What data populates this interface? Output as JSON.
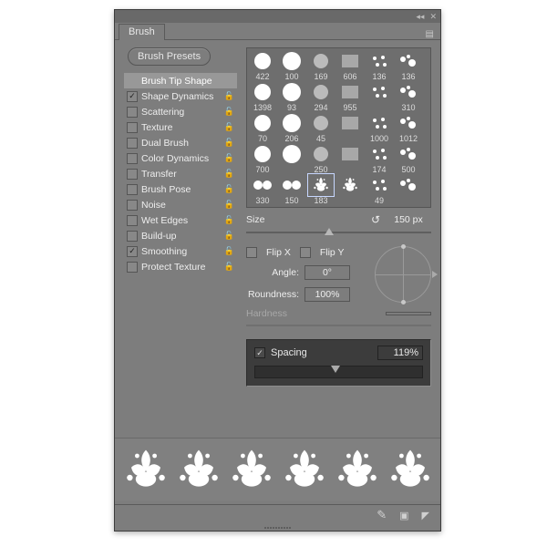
{
  "tab": "Brush",
  "presets_button": "Brush Presets",
  "options": [
    {
      "label": "Brush Tip Shape",
      "checkbox": null,
      "selected": true,
      "lock": false
    },
    {
      "label": "Shape Dynamics",
      "checkbox": true,
      "selected": false,
      "lock": true
    },
    {
      "label": "Scattering",
      "checkbox": false,
      "selected": false,
      "lock": true
    },
    {
      "label": "Texture",
      "checkbox": false,
      "selected": false,
      "lock": true
    },
    {
      "label": "Dual Brush",
      "checkbox": false,
      "selected": false,
      "lock": true
    },
    {
      "label": "Color Dynamics",
      "checkbox": false,
      "selected": false,
      "lock": true
    },
    {
      "label": "Transfer",
      "checkbox": false,
      "selected": false,
      "lock": true
    },
    {
      "label": "Brush Pose",
      "checkbox": false,
      "selected": false,
      "lock": true
    },
    {
      "label": "Noise",
      "checkbox": false,
      "selected": false,
      "lock": true
    },
    {
      "label": "Wet Edges",
      "checkbox": false,
      "selected": false,
      "lock": true
    },
    {
      "label": "Build-up",
      "checkbox": false,
      "selected": false,
      "lock": true
    },
    {
      "label": "Smoothing",
      "checkbox": true,
      "selected": false,
      "lock": true
    },
    {
      "label": "Protect Texture",
      "checkbox": false,
      "selected": false,
      "lock": true
    }
  ],
  "swatch_rows": [
    [
      "422",
      "100",
      "169",
      "606",
      "136",
      "136"
    ],
    [
      "1398",
      "93",
      "294",
      "955",
      "",
      "310"
    ],
    [
      "70",
      "206",
      "45",
      "",
      "1000",
      "1012"
    ],
    [
      "700",
      "",
      "250",
      "",
      "174",
      "500"
    ],
    [
      "330",
      "150",
      "183",
      "",
      "49",
      ""
    ]
  ],
  "selected_swatch": {
    "row": 4,
    "col": 2
  },
  "size": {
    "label": "Size",
    "value": "150 px",
    "knob_pct": 45
  },
  "flipx": {
    "label": "Flip X",
    "checked": false
  },
  "flipy": {
    "label": "Flip Y",
    "checked": false
  },
  "angle": {
    "label": "Angle:",
    "value": "0°"
  },
  "roundness": {
    "label": "Roundness:",
    "value": "100%"
  },
  "hardness": {
    "label": "Hardness"
  },
  "spacing": {
    "label": "Spacing",
    "checked": true,
    "value": "119%",
    "knob_pct": 48
  },
  "icons": {
    "collapse": "◂◂",
    "close": "✕",
    "reset": "↺",
    "lock": "🔒",
    "menu": "▤"
  }
}
